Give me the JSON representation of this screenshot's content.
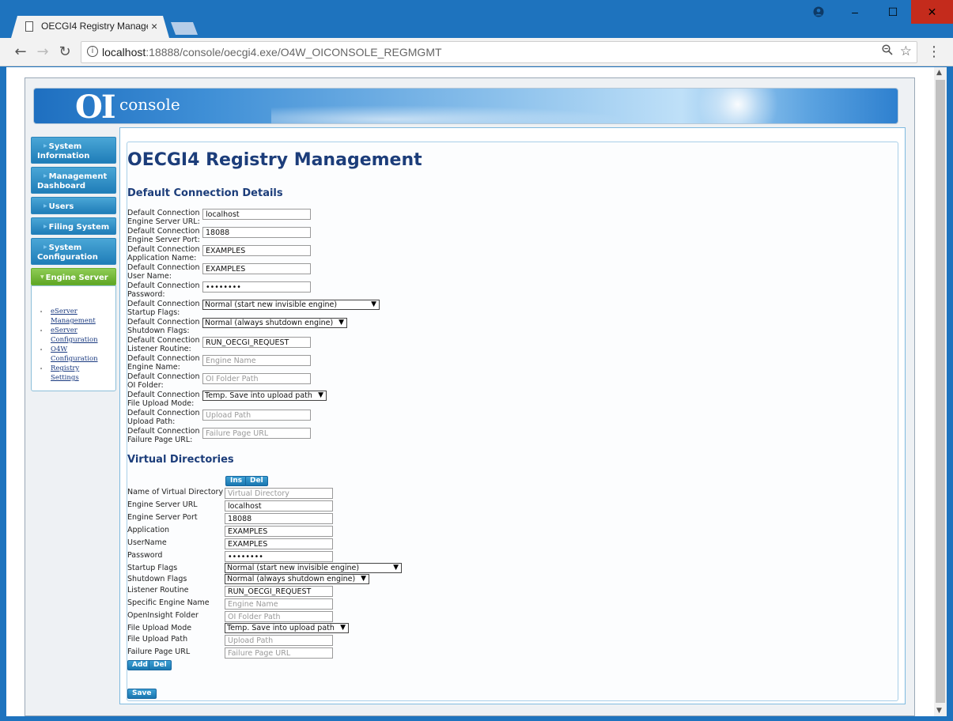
{
  "browser": {
    "tab_title": "OECGI4 Registry Manage",
    "tab_close": "×",
    "url_host": "localhost",
    "url_rest": ":18888/console/oecgi4.exe/O4W_OICONSOLE_REGMGMT",
    "window_controls": {
      "minimize": "–",
      "maximize": "☐",
      "close": "✕"
    }
  },
  "banner": {
    "logo_oi": "OI",
    "logo_console": "console"
  },
  "sidebar": {
    "items": [
      {
        "line1": "System",
        "line2": "Information"
      },
      {
        "line1": "Management",
        "line2": "Dashboard"
      },
      {
        "line1": "Users",
        "line2": ""
      },
      {
        "line1": "Filing System",
        "line2": ""
      },
      {
        "line1": "System",
        "line2": "Configuration"
      },
      {
        "line1": "Engine Server",
        "line2": ""
      }
    ],
    "submenu": [
      {
        "line1": "eServer",
        "line2": "Management"
      },
      {
        "line1": "eServer",
        "line2": "Configuration"
      },
      {
        "line1": "O4W",
        "line2": "Configuration"
      },
      {
        "line1": "Registry",
        "line2": "Settings"
      }
    ]
  },
  "page": {
    "title": "OECGI4 Registry Management",
    "default_section_title": "Default Connection Details",
    "virtual_section_title": "Virtual Directories"
  },
  "default_fields": [
    {
      "l1": "Default Connection",
      "l2": "Engine Server URL:",
      "value": "localhost",
      "placeholder": ""
    },
    {
      "l1": "Default Connection",
      "l2": "Engine Server Port:",
      "value": "18088",
      "placeholder": ""
    },
    {
      "l1": "Default Connection",
      "l2": "Application Name:",
      "value": "EXAMPLES",
      "placeholder": ""
    },
    {
      "l1": "Default Connection",
      "l2": "User Name:",
      "value": "EXAMPLES",
      "placeholder": ""
    },
    {
      "l1": "Default Connection",
      "l2": "Password:",
      "value": "••••••••",
      "placeholder": ""
    },
    {
      "l1": "Default Connection",
      "l2": "Startup Flags:",
      "value": "Normal (start new invisible engine)",
      "placeholder": ""
    },
    {
      "l1": "Default Connection",
      "l2": "Shutdown Flags:",
      "value": "Normal (always shutdown engine)",
      "placeholder": ""
    },
    {
      "l1": "Default Connection",
      "l2": "Listener Routine:",
      "value": "RUN_OECGI_REQUEST",
      "placeholder": ""
    },
    {
      "l1": "Default Connection",
      "l2": "Engine Name:",
      "value": "",
      "placeholder": "Engine Name"
    },
    {
      "l1": "Default Connection",
      "l2": "OI Folder:",
      "value": "",
      "placeholder": "OI Folder Path"
    },
    {
      "l1": "Default Connection",
      "l2": "File Upload Mode:",
      "value": "Temp. Save into upload path",
      "placeholder": ""
    },
    {
      "l1": "Default Connection",
      "l2": "Upload Path:",
      "value": "",
      "placeholder": "Upload Path"
    },
    {
      "l1": "Default Connection",
      "l2": "Failure Page URL:",
      "value": "",
      "placeholder": "Failure Page URL"
    }
  ],
  "virtual_fields": [
    {
      "label": "Name of Virtual Directory",
      "value": "",
      "placeholder": "Virtual Directory"
    },
    {
      "label": "Engine Server URL",
      "value": "localhost",
      "placeholder": ""
    },
    {
      "label": "Engine Server Port",
      "value": "18088",
      "placeholder": ""
    },
    {
      "label": "Application",
      "value": "EXAMPLES",
      "placeholder": ""
    },
    {
      "label": "UserName",
      "value": "EXAMPLES",
      "placeholder": ""
    },
    {
      "label": "Password",
      "value": "••••••••",
      "placeholder": ""
    },
    {
      "label": "Startup Flags",
      "value": "Normal (start new invisible engine)",
      "placeholder": ""
    },
    {
      "label": "Shutdown Flags",
      "value": "Normal (always shutdown engine)",
      "placeholder": ""
    },
    {
      "label": "Listener Routine",
      "value": "RUN_OECGI_REQUEST",
      "placeholder": ""
    },
    {
      "label": "Specific Engine Name",
      "value": "",
      "placeholder": "Engine Name"
    },
    {
      "label": "OpenInsight Folder",
      "value": "",
      "placeholder": "OI Folder Path"
    },
    {
      "label": "File Upload Mode",
      "value": "Temp. Save into upload path",
      "placeholder": ""
    },
    {
      "label": "File Upload Path",
      "value": "",
      "placeholder": "Upload Path"
    },
    {
      "label": "Failure Page URL",
      "value": "",
      "placeholder": "Failure Page URL"
    }
  ],
  "buttons": {
    "ins": "Ins",
    "del": "Del",
    "add": "Add",
    "del2": "Del",
    "save": "Save"
  },
  "icons": {
    "select_caret": "▼",
    "submenu_bullet": "•"
  }
}
